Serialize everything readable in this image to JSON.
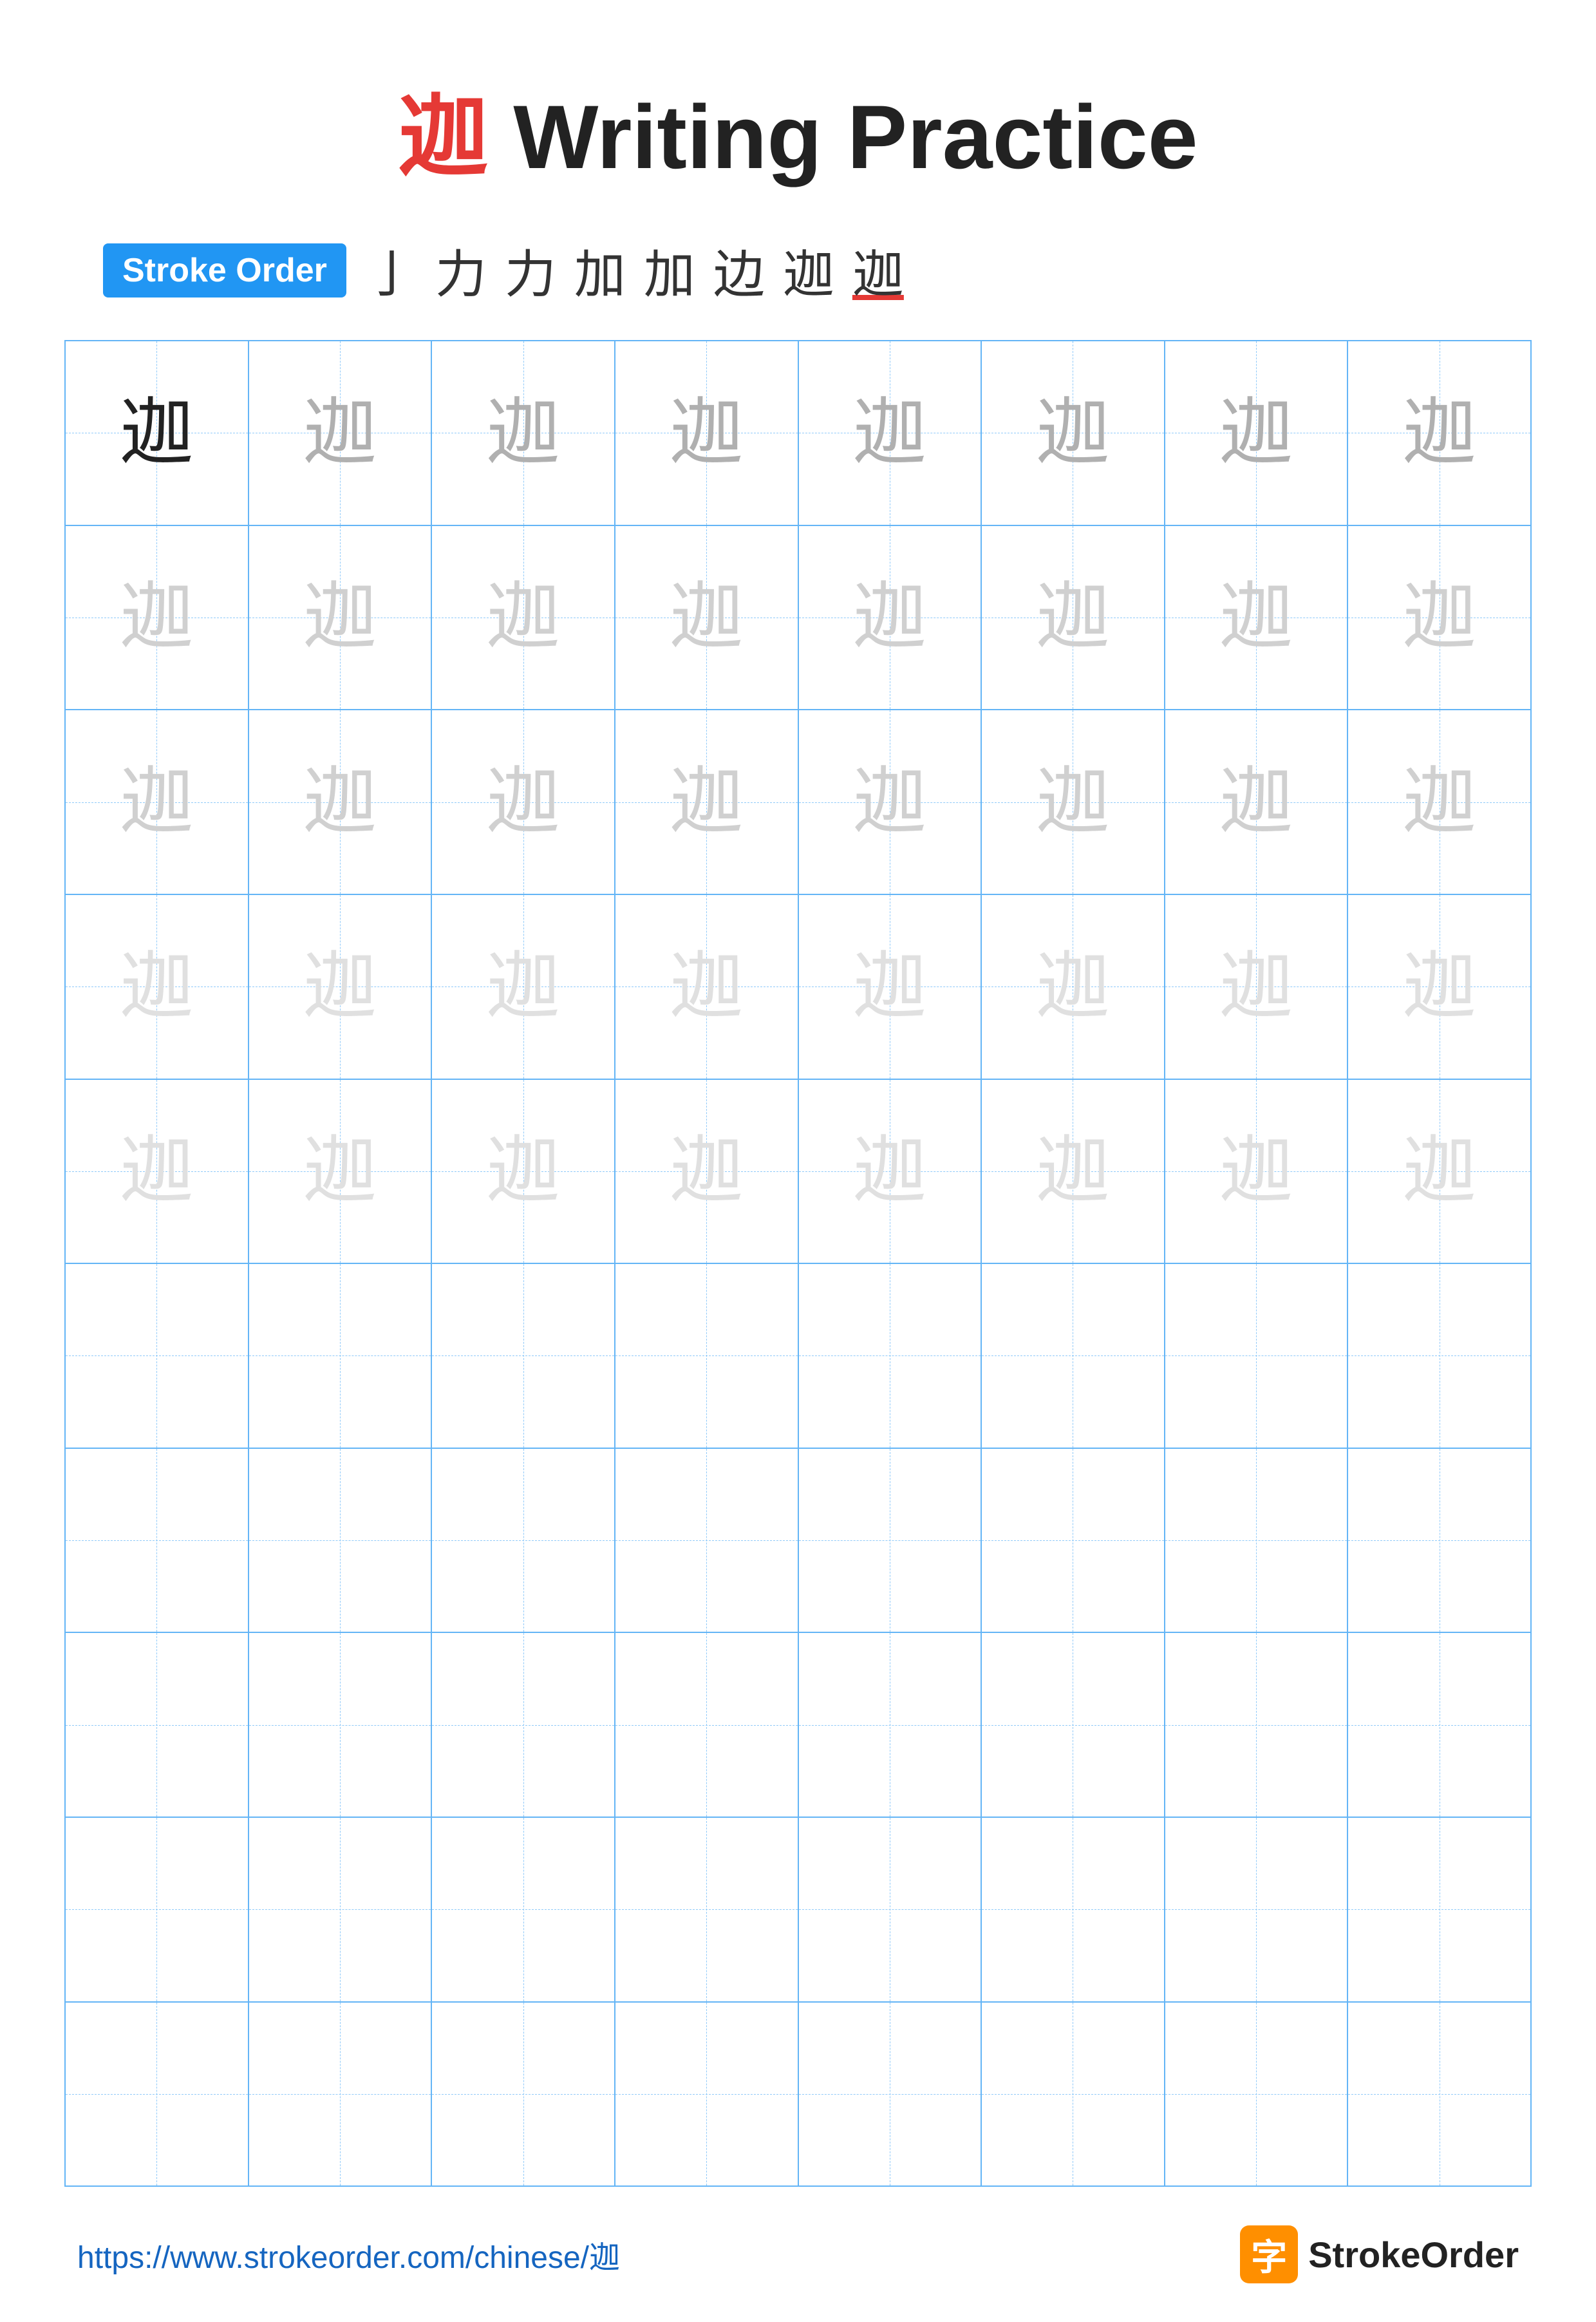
{
  "title": {
    "char": "迦",
    "text": "Writing Practice"
  },
  "stroke_order": {
    "badge": "Stroke Order",
    "strokes": [
      "亅",
      "力",
      "力",
      "加",
      "加",
      "边",
      "迦",
      "迦"
    ]
  },
  "grid": {
    "cols": 8,
    "rows": [
      {
        "cells": [
          {
            "char": "迦",
            "style": "dark"
          },
          {
            "char": "迦",
            "style": "medium"
          },
          {
            "char": "迦",
            "style": "medium"
          },
          {
            "char": "迦",
            "style": "medium"
          },
          {
            "char": "迦",
            "style": "medium"
          },
          {
            "char": "迦",
            "style": "medium"
          },
          {
            "char": "迦",
            "style": "medium"
          },
          {
            "char": "迦",
            "style": "medium"
          }
        ]
      },
      {
        "cells": [
          {
            "char": "迦",
            "style": "light"
          },
          {
            "char": "迦",
            "style": "light"
          },
          {
            "char": "迦",
            "style": "light"
          },
          {
            "char": "迦",
            "style": "light"
          },
          {
            "char": "迦",
            "style": "light"
          },
          {
            "char": "迦",
            "style": "light"
          },
          {
            "char": "迦",
            "style": "light"
          },
          {
            "char": "迦",
            "style": "light"
          }
        ]
      },
      {
        "cells": [
          {
            "char": "迦",
            "style": "light"
          },
          {
            "char": "迦",
            "style": "light"
          },
          {
            "char": "迦",
            "style": "light"
          },
          {
            "char": "迦",
            "style": "light"
          },
          {
            "char": "迦",
            "style": "light"
          },
          {
            "char": "迦",
            "style": "light"
          },
          {
            "char": "迦",
            "style": "light"
          },
          {
            "char": "迦",
            "style": "light"
          }
        ]
      },
      {
        "cells": [
          {
            "char": "迦",
            "style": "lighter"
          },
          {
            "char": "迦",
            "style": "lighter"
          },
          {
            "char": "迦",
            "style": "lighter"
          },
          {
            "char": "迦",
            "style": "lighter"
          },
          {
            "char": "迦",
            "style": "lighter"
          },
          {
            "char": "迦",
            "style": "lighter"
          },
          {
            "char": "迦",
            "style": "lighter"
          },
          {
            "char": "迦",
            "style": "lighter"
          }
        ]
      },
      {
        "cells": [
          {
            "char": "迦",
            "style": "lighter"
          },
          {
            "char": "迦",
            "style": "lighter"
          },
          {
            "char": "迦",
            "style": "lighter"
          },
          {
            "char": "迦",
            "style": "lighter"
          },
          {
            "char": "迦",
            "style": "lighter"
          },
          {
            "char": "迦",
            "style": "lighter"
          },
          {
            "char": "迦",
            "style": "lighter"
          },
          {
            "char": "迦",
            "style": "lighter"
          }
        ]
      },
      {
        "cells": [
          {
            "char": "",
            "style": "empty"
          },
          {
            "char": "",
            "style": "empty"
          },
          {
            "char": "",
            "style": "empty"
          },
          {
            "char": "",
            "style": "empty"
          },
          {
            "char": "",
            "style": "empty"
          },
          {
            "char": "",
            "style": "empty"
          },
          {
            "char": "",
            "style": "empty"
          },
          {
            "char": "",
            "style": "empty"
          }
        ]
      },
      {
        "cells": [
          {
            "char": "",
            "style": "empty"
          },
          {
            "char": "",
            "style": "empty"
          },
          {
            "char": "",
            "style": "empty"
          },
          {
            "char": "",
            "style": "empty"
          },
          {
            "char": "",
            "style": "empty"
          },
          {
            "char": "",
            "style": "empty"
          },
          {
            "char": "",
            "style": "empty"
          },
          {
            "char": "",
            "style": "empty"
          }
        ]
      },
      {
        "cells": [
          {
            "char": "",
            "style": "empty"
          },
          {
            "char": "",
            "style": "empty"
          },
          {
            "char": "",
            "style": "empty"
          },
          {
            "char": "",
            "style": "empty"
          },
          {
            "char": "",
            "style": "empty"
          },
          {
            "char": "",
            "style": "empty"
          },
          {
            "char": "",
            "style": "empty"
          },
          {
            "char": "",
            "style": "empty"
          }
        ]
      },
      {
        "cells": [
          {
            "char": "",
            "style": "empty"
          },
          {
            "char": "",
            "style": "empty"
          },
          {
            "char": "",
            "style": "empty"
          },
          {
            "char": "",
            "style": "empty"
          },
          {
            "char": "",
            "style": "empty"
          },
          {
            "char": "",
            "style": "empty"
          },
          {
            "char": "",
            "style": "empty"
          },
          {
            "char": "",
            "style": "empty"
          }
        ]
      },
      {
        "cells": [
          {
            "char": "",
            "style": "empty"
          },
          {
            "char": "",
            "style": "empty"
          },
          {
            "char": "",
            "style": "empty"
          },
          {
            "char": "",
            "style": "empty"
          },
          {
            "char": "",
            "style": "empty"
          },
          {
            "char": "",
            "style": "empty"
          },
          {
            "char": "",
            "style": "empty"
          },
          {
            "char": "",
            "style": "empty"
          }
        ]
      }
    ]
  },
  "footer": {
    "url": "https://www.strokeorder.com/chinese/迦",
    "brand_name": "StrokeOrder",
    "brand_char": "字"
  }
}
